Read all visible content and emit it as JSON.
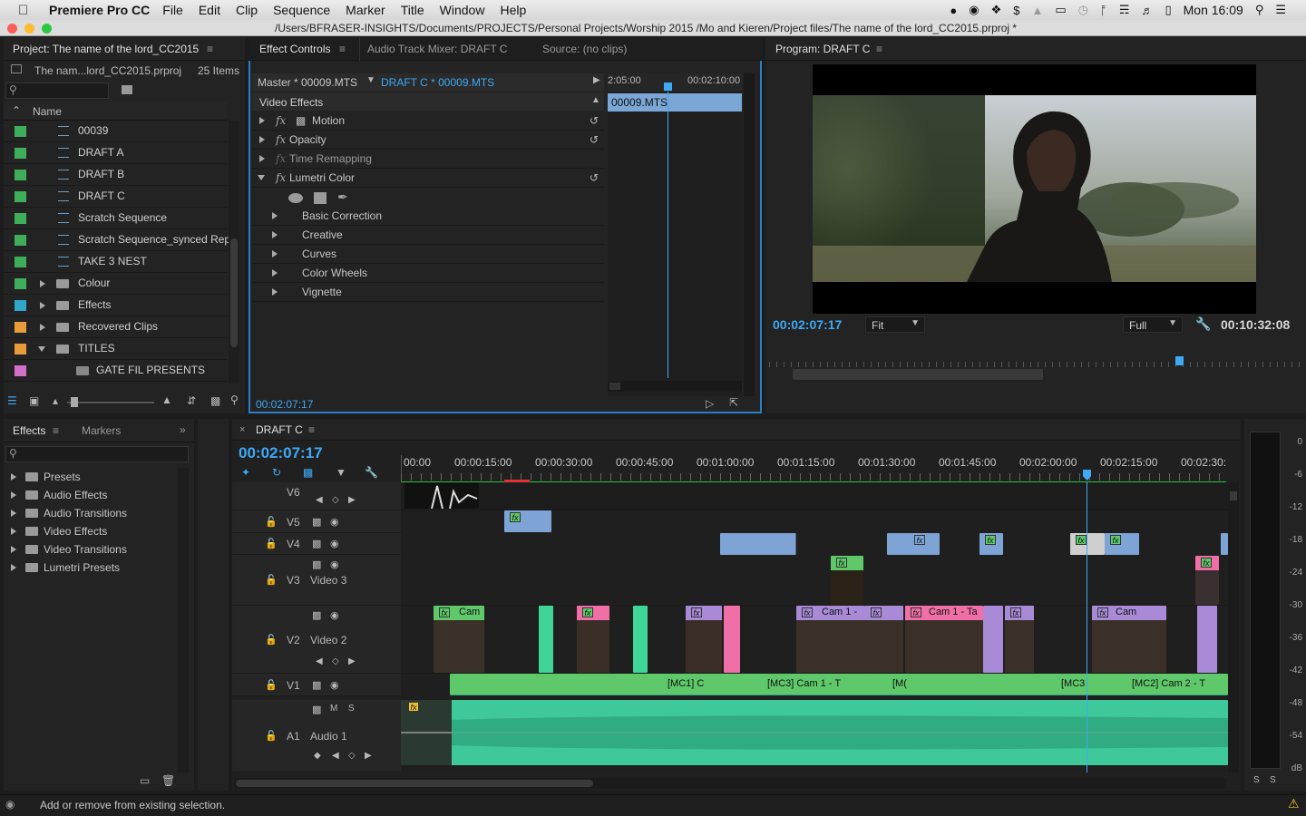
{
  "menubar": {
    "app": "Premiere Pro CC",
    "items": [
      "File",
      "Edit",
      "Clip",
      "Sequence",
      "Marker",
      "Title",
      "Window",
      "Help"
    ],
    "clock": "Mon 16:09"
  },
  "window": {
    "path": "/Users/BFRASER-INSIGHTS/Documents/PROJECTS/Personal Projects/Worship 2015 /Mo and Kieren/Project files/The name of the lord_CC2015.prproj *"
  },
  "project": {
    "tab": "Project: The name of the lord_CC2015",
    "file": "The nam...lord_CC2015.prproj",
    "count": "25 Items",
    "col": "Name",
    "items": [
      {
        "name": "00039",
        "color": "#3fae5a",
        "type": "seq"
      },
      {
        "name": "DRAFT A",
        "color": "#3fae5a",
        "type": "seq"
      },
      {
        "name": "DRAFT B",
        "color": "#3fae5a",
        "type": "seq"
      },
      {
        "name": "DRAFT C",
        "color": "#3fae5a",
        "type": "seq"
      },
      {
        "name": "Scratch Sequence",
        "color": "#3fae5a",
        "type": "seq"
      },
      {
        "name": "Scratch Sequence_synced Repl",
        "color": "#3fae5a",
        "type": "seq"
      },
      {
        "name": "TAKE 3 NEST",
        "color": "#3fae5a",
        "type": "seq"
      },
      {
        "name": "Colour",
        "color": "#3fae5a",
        "type": "folder"
      },
      {
        "name": "Effects",
        "color": "#2ea7c9",
        "type": "folder"
      },
      {
        "name": "Recovered Clips",
        "color": "#e89b3a",
        "type": "folder"
      },
      {
        "name": "TITLES",
        "color": "#e89b3a",
        "type": "folder-open"
      },
      {
        "name": "GATE FIL PRESENTS",
        "color": "#d36fc6",
        "type": "title"
      }
    ]
  },
  "effectControls": {
    "tabs": [
      "Effect Controls",
      "Audio Track Mixer: DRAFT C",
      "Source: (no clips)"
    ],
    "master": "Master * 00009.MTS",
    "seq": "DRAFT C * 00009.MTS",
    "t1": "2:05:00",
    "t2": "00:02:10:00",
    "clipName": "00009.MTS",
    "section": "Video Effects",
    "effects": [
      "Motion",
      "Opacity",
      "Time Remapping",
      "Lumetri Color"
    ],
    "lumetri": [
      "Basic Correction",
      "Creative",
      "Curves",
      "Color Wheels",
      "Vignette"
    ],
    "time": "00:02:07:17"
  },
  "program": {
    "tab": "Program: DRAFT C",
    "timecode": "00:02:07:17",
    "fit": "Fit",
    "quality": "Full",
    "duration": "00:10:32:08"
  },
  "effects": {
    "tabs": [
      "Effects",
      "Markers"
    ],
    "items": [
      "Presets",
      "Audio Effects",
      "Audio Transitions",
      "Video Effects",
      "Video Transitions",
      "Lumetri Presets"
    ]
  },
  "timeline": {
    "tab": "DRAFT C",
    "timecode": "00:02:07:17",
    "ruler": [
      "00:00",
      "00:00:15:00",
      "00:00:30:00",
      "00:00:45:00",
      "00:01:00:00",
      "00:01:15:00",
      "00:01:30:00",
      "00:01:45:00",
      "00:02:00:00",
      "00:02:15:00",
      "00:02:30:"
    ],
    "tracks": [
      "V6",
      "V5",
      "V4",
      "V3",
      "V2",
      "V1",
      "A1"
    ],
    "trackNames": {
      "v3": "Video 3",
      "v2": "Video 2",
      "a1": "Audio 1"
    },
    "clipLabels": {
      "cam": "Cam",
      "cam1": "Cam 1 -",
      "cam1t": "Cam 1 - Ta",
      "cam2": "Cam",
      "mc1": "[MC1] C",
      "mc3": "[MC3] Cam 1 - T",
      "mcm": "[M(",
      "mc3b": "[MC3",
      "mc2": "[MC2] Cam 2 - T"
    },
    "ms": [
      "M",
      "S"
    ]
  },
  "meter": {
    "labels": [
      "0",
      "-6",
      "-12",
      "-18",
      "-24",
      "-30",
      "-36",
      "-42",
      "-48",
      "-54",
      "dB"
    ],
    "solo": [
      "S",
      "S"
    ]
  },
  "status": "Add or remove from existing selection."
}
